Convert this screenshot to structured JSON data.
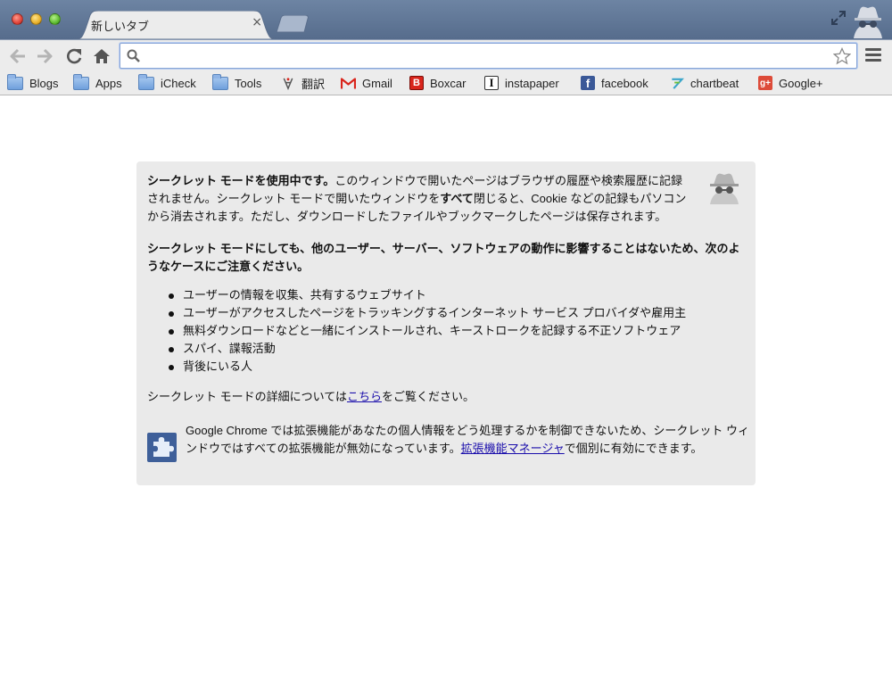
{
  "tab": {
    "title": "新しいタブ",
    "close_glyph": "×"
  },
  "omnibox": {
    "value": "",
    "placeholder": ""
  },
  "bookmarks": [
    {
      "label": "Blogs",
      "icon": "folder-icon"
    },
    {
      "label": "Apps",
      "icon": "folder-icon"
    },
    {
      "label": "iCheck",
      "icon": "folder-icon"
    },
    {
      "label": "Tools",
      "icon": "folder-icon"
    },
    {
      "label": "翻訳",
      "icon": "translate-icon"
    },
    {
      "label": "Gmail",
      "icon": "gmail-icon"
    },
    {
      "label": "Boxcar",
      "icon": "boxcar-icon",
      "glyph": "B",
      "color": "#d9251c"
    },
    {
      "label": "instapaper",
      "icon": "instapaper-icon",
      "glyph": "I"
    },
    {
      "label": "facebook",
      "icon": "facebook-icon",
      "glyph": "f",
      "color": "#3b5998"
    },
    {
      "label": "chartbeat",
      "icon": "chartbeat-icon"
    },
    {
      "label": "Google+",
      "icon": "google-plus-icon",
      "glyph": "g+",
      "color": "#dd4b39"
    }
  ],
  "incognito": {
    "p1_bold": "シークレット モードを使用中です。",
    "p1_a": "このウィンドウで開いたページはブラウザの履歴や検索履歴に記録されません。シークレット モードで開いたウィンドウを",
    "p1_bold2": "すべて",
    "p1_b": "閉じると、Cookie などの記録もパソコンから消去されます。ただし、ダウンロードしたファイルやブックマークしたページは保存されます。",
    "p2": "シークレット モードにしても、他のユーザー、サーバー、ソフトウェアの動作に影響することはないため、次のようなケースにご注意ください。",
    "risks": [
      "ユーザーの情報を収集、共有するウェブサイト",
      "ユーザーがアクセスしたページをトラッキングするインターネット サービス プロバイダや雇用主",
      "無料ダウンロードなどと一緒にインストールされ、キーストロークを記録する不正ソフトウェア",
      "スパイ、諜報活動",
      "背後にいる人"
    ],
    "p3_a": "シークレット モードの詳細については",
    "p3_link": "こちら",
    "p3_b": "をご覧ください。",
    "ext_a": "Google Chrome では拡張機能があなたの個人情報をどう処理するかを制御できないため、シークレット ウィンドウではすべての拡張機能が無効になっています。",
    "ext_link": "拡張機能マネージャ",
    "ext_b": "で個別に有効にできます。"
  },
  "colors": {
    "link": "#1a0dab",
    "titlebar": "#6d84a3",
    "content_bg": "#eaeaea"
  }
}
